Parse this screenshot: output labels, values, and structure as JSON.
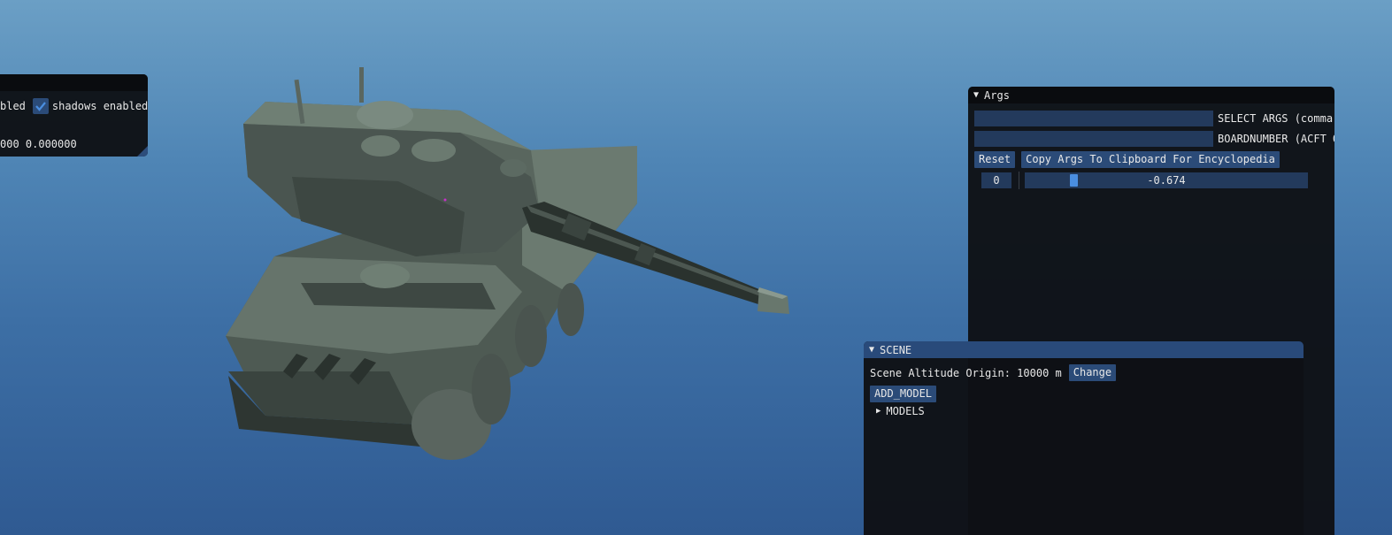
{
  "render_panel": {
    "partial_label": "bled",
    "shadows_label": "shadows enabled",
    "shadows_checked": true,
    "values_text": "000 0.000000"
  },
  "args_panel": {
    "title": "Args",
    "select_args_value": "",
    "select_args_label": "SELECT ARGS (comma s",
    "boardnumber_value": "",
    "boardnumber_label": "BOARDNUMBER (ACFT ON",
    "reset_label": "Reset",
    "copy_label": "Copy Args To Clipboard For Encyclopedia",
    "arg_index": "0",
    "arg_value": "-0.674",
    "slider_fraction": 0.163
  },
  "scene_panel": {
    "title": "SCENE",
    "altitude_label": "Scene Altitude Origin: 10000 m",
    "change_label": "Change",
    "add_model_label": "ADD_MODEL",
    "models_label": "MODELS"
  },
  "colors": {
    "sky_top": "#6b9fc5",
    "sky_bottom": "#2f5a92",
    "panel_bg": "#0f1115",
    "title_active": "#294a7a",
    "widget_bg": "#233a5c",
    "button_bg": "#2b4b78",
    "accent": "#4a8ee0",
    "vehicle": "#5c6a62"
  }
}
